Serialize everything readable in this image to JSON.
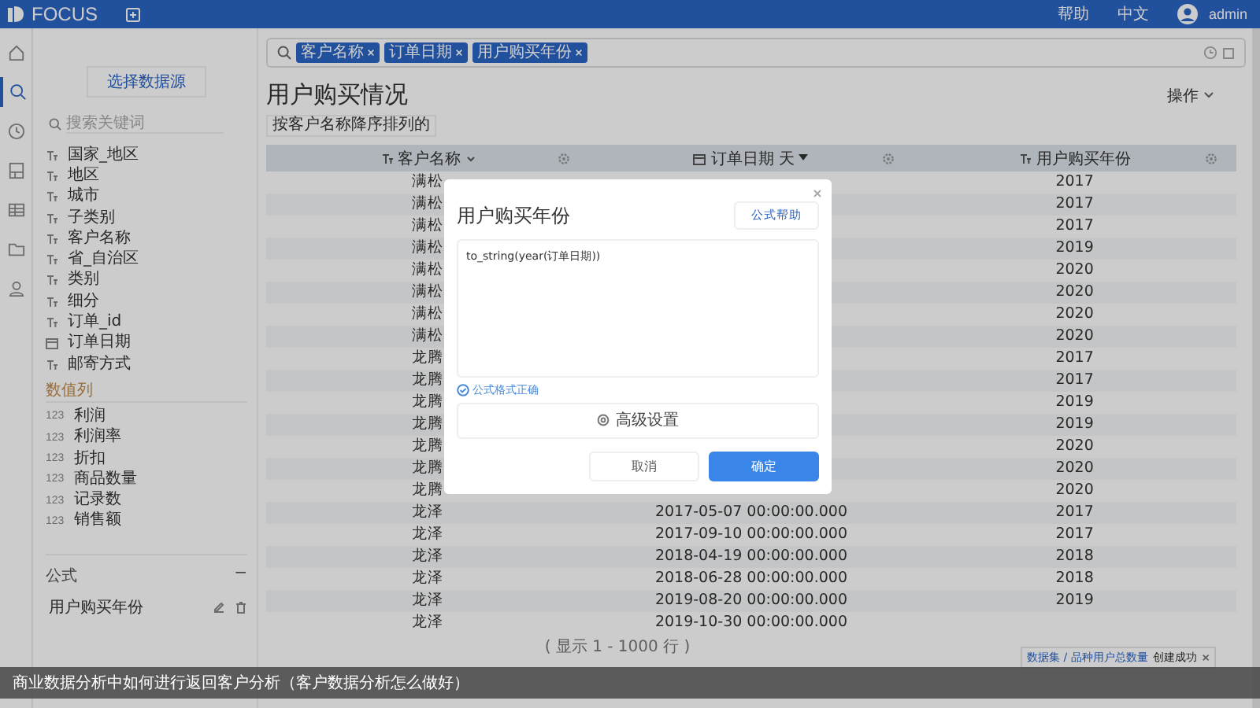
{
  "topbar": {
    "logo": "FOCUS",
    "links": [
      "帮助",
      "中文"
    ],
    "user": "admin"
  },
  "rail": [
    {
      "kind": "home",
      "selected": false
    },
    {
      "kind": "search",
      "selected": true
    },
    {
      "kind": "clock",
      "selected": false
    },
    {
      "kind": "board",
      "selected": false
    },
    {
      "kind": "table",
      "selected": false
    },
    {
      "kind": "folder",
      "selected": false
    },
    {
      "kind": "user",
      "selected": false
    }
  ],
  "sidebar": {
    "source_button": "选择数据源",
    "search": {
      "placeholder": "搜索关键词"
    },
    "attributes": [
      {
        "kind": "text",
        "label": "国家_地区"
      },
      {
        "kind": "text",
        "label": "地区"
      },
      {
        "kind": "text",
        "label": "城市"
      },
      {
        "kind": "text",
        "label": "子类别"
      },
      {
        "kind": "text",
        "label": "客户名称"
      },
      {
        "kind": "text",
        "label": "省_自治区"
      },
      {
        "kind": "text",
        "label": "类别"
      },
      {
        "kind": "text",
        "label": "细分"
      },
      {
        "kind": "text",
        "label": "订单_id"
      },
      {
        "kind": "date",
        "label": "订单日期"
      },
      {
        "kind": "text",
        "label": "邮寄方式"
      }
    ],
    "measures_title": "数值列",
    "measures": [
      {
        "type_label": "123",
        "label": "利润"
      },
      {
        "type_label": "123",
        "label": "利润率"
      },
      {
        "type_label": "123",
        "label": "折扣"
      },
      {
        "type_label": "123",
        "label": "商品数量"
      },
      {
        "type_label": "123",
        "label": "记录数"
      },
      {
        "type_label": "123",
        "label": "销售额"
      }
    ],
    "formula_title": "公式",
    "formula_collapse": "−",
    "formulas": [
      "用户购买年份"
    ]
  },
  "search_bar": {
    "chips": [
      "客户名称",
      "订单日期",
      "用户购买年份"
    ]
  },
  "title": "用户购买情况",
  "sort_tag": "按客户名称降序排列的",
  "actions": "操作",
  "table": {
    "columns": [
      {
        "kind": "text",
        "label": "客户名称",
        "sorted": true
      },
      {
        "kind": "date",
        "label": "订单日期",
        "granularity": "天",
        "sorted": false
      },
      {
        "kind": "text",
        "label": "用户购买年份",
        "sorted": false
      }
    ],
    "rows": [
      {
        "customer": "满松",
        "year": "2017"
      },
      {
        "customer": "满松",
        "year": "2017"
      },
      {
        "customer": "满松",
        "year": "2017"
      },
      {
        "customer": "满松",
        "year": "2019"
      },
      {
        "customer": "满松",
        "year": "2020"
      },
      {
        "customer": "满松",
        "year": "2020"
      },
      {
        "customer": "满松",
        "year": "2020"
      },
      {
        "customer": "满松",
        "year": "2020"
      },
      {
        "customer": "龙腾",
        "year": "2017"
      },
      {
        "customer": "龙腾",
        "year": "2017"
      },
      {
        "customer": "龙腾",
        "year": "2019"
      },
      {
        "customer": "龙腾",
        "year": "2019"
      },
      {
        "customer": "龙腾",
        "year": "2020"
      },
      {
        "customer": "龙腾",
        "year": "2020"
      },
      {
        "customer": "龙腾",
        "year": "2020"
      },
      {
        "customer": "龙泽",
        "date": "2017-05-07 00:00:00.000",
        "year": "2017"
      },
      {
        "customer": "龙泽",
        "date": "2017-09-10 00:00:00.000",
        "year": "2017"
      },
      {
        "customer": "龙泽",
        "date": "2018-04-19 00:00:00.000",
        "year": "2018"
      },
      {
        "customer": "龙泽",
        "date": "2018-06-28 00:00:00.000",
        "year": "2018"
      },
      {
        "customer": "龙泽",
        "date": "2019-08-20 00:00:00.000",
        "year": "2019"
      },
      {
        "customer": "龙泽",
        "date": "2019-10-30 00:00:00.000"
      }
    ],
    "footer": "( 显示 1 - 1000 行 )"
  },
  "modal": {
    "title": "用户购买年份",
    "help_button": "公式帮助",
    "formula": "to_string(year(订单日期))",
    "valid": true,
    "valid_text": "公式格式正确",
    "advanced": "高级设置",
    "cancel": "取消",
    "confirm": "确定"
  },
  "toast": {
    "link": "数据集 / 品种用户总数量",
    "message": "创建成功"
  },
  "caption": "商业数据分析中如何进行返回客户分析（客户数据分析怎么做好）"
}
